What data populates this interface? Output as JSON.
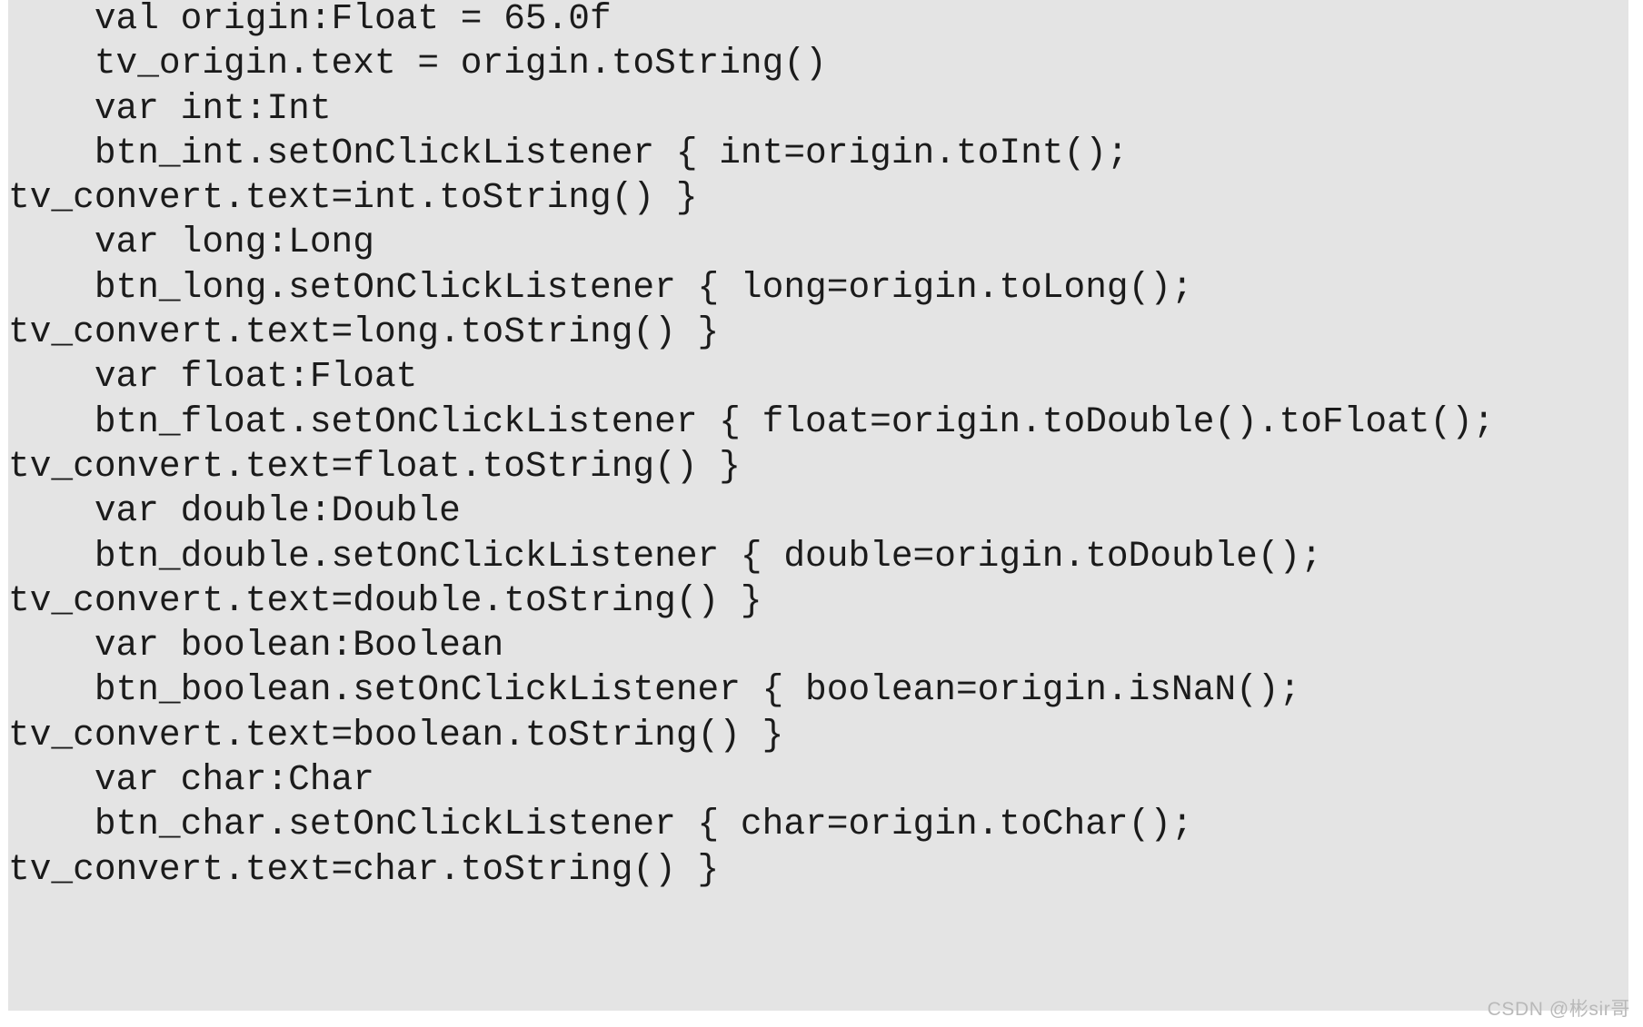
{
  "page": {
    "background_color": "#ffffff",
    "code_block_background": "#e4e4e4",
    "text_color": "#1b1b1b"
  },
  "code_block": {
    "language": "kotlin",
    "lines": [
      "    val origin:Float = 65.0f",
      "    tv_origin.text = origin.toString()",
      "    var int:Int",
      "    btn_int.setOnClickListener { int=origin.toInt();",
      "tv_convert.text=int.toString() }",
      "    var long:Long",
      "    btn_long.setOnClickListener { long=origin.toLong();",
      "tv_convert.text=long.toString() }",
      "    var float:Float",
      "    btn_float.setOnClickListener { float=origin.toDouble().toFloat();",
      "tv_convert.text=float.toString() }",
      "    var double:Double",
      "    btn_double.setOnClickListener { double=origin.toDouble();",
      "tv_convert.text=double.toString() }",
      "    var boolean:Boolean",
      "    btn_boolean.setOnClickListener { boolean=origin.isNaN();",
      "tv_convert.text=boolean.toString() }",
      "    var char:Char",
      "    btn_char.setOnClickListener { char=origin.toChar();",
      "tv_convert.text=char.toString() }"
    ]
  },
  "watermark": {
    "text": "CSDN @彬sir哥",
    "color": "#b9b9b9"
  }
}
